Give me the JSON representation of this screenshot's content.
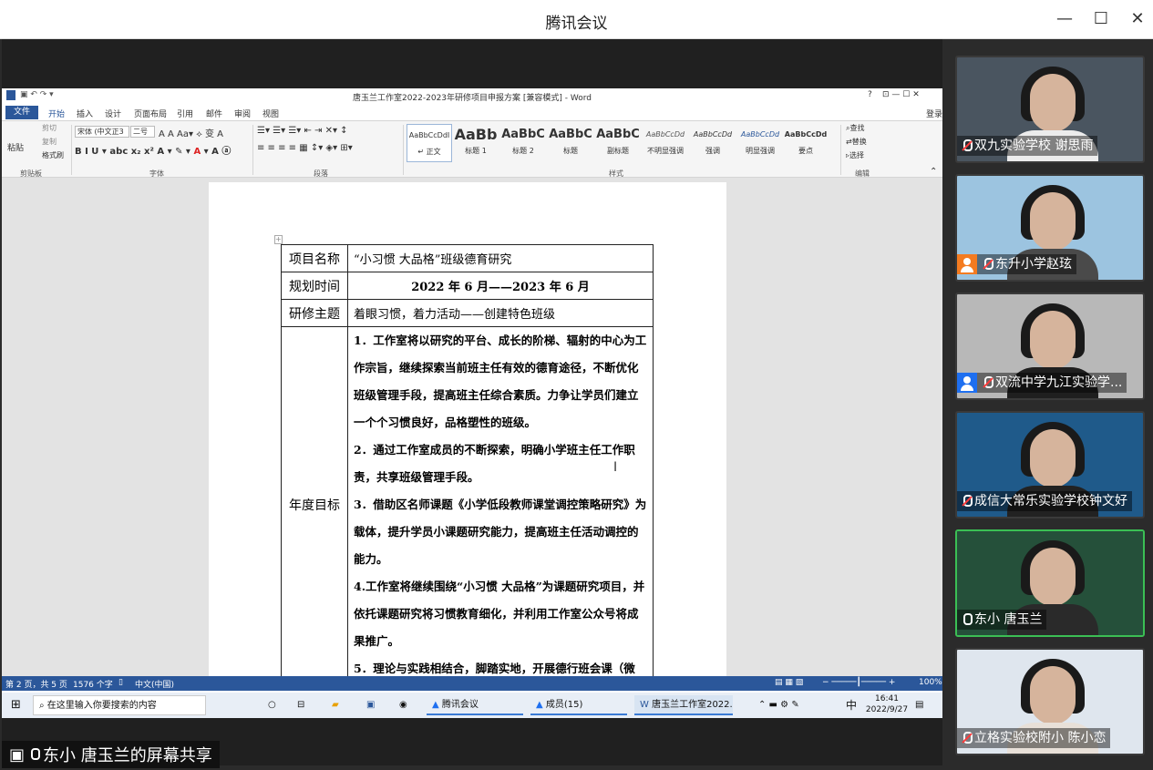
{
  "app": {
    "title": "腾讯会议"
  },
  "window_controls": {
    "minimize": "—",
    "maximize": "☐",
    "close": "✕"
  },
  "word": {
    "title": "唐玉兰工作室2022-2023年研修项目申报方案 [兼容模式] - Word",
    "help": "?",
    "login": "登录",
    "tabs": [
      "文件",
      "开始",
      "插入",
      "设计",
      "页面布局",
      "引用",
      "邮件",
      "审阅",
      "视图"
    ],
    "clipboard": {
      "paste": "粘贴",
      "cut": "剪切",
      "copy": "复制",
      "format_painter": "格式刷",
      "group": "剪贴板"
    },
    "font": {
      "name": "宋体 (中文正3",
      "size": "二号",
      "group": "字体"
    },
    "paragraph_group": "段落",
    "styles": [
      {
        "preview": "AaBbCcDdI",
        "label": "↵ 正文"
      },
      {
        "preview": "AaBb",
        "label": "标题 1"
      },
      {
        "preview": "AaBbC",
        "label": "标题 2"
      },
      {
        "preview": "AaBbC",
        "label": "标题"
      },
      {
        "preview": "AaBbC",
        "label": "副标题"
      },
      {
        "preview": "AaBbCcDd",
        "label": "不明显强调"
      },
      {
        "preview": "AaBbCcDd",
        "label": "强调"
      },
      {
        "preview": "AaBbCcDd",
        "label": "明显强调"
      },
      {
        "preview": "AaBbCcDd",
        "label": "要点"
      }
    ],
    "styles_group": "样式",
    "editing": {
      "find": "查找",
      "replace": "替换",
      "select": "选择",
      "group": "编辑"
    },
    "table": {
      "rows": [
        {
          "label": "项目名称",
          "value": "“小习惯 大品格”班级德育研究"
        },
        {
          "label": "规划时间",
          "value": "2022 年 6 月——2023 年 6 月"
        },
        {
          "label": "研修主题",
          "value": "着眼习惯，着力活动——创建特色班级"
        }
      ],
      "goal_label": "年度目标",
      "goals": [
        "1．工作室将以研究的平台、成长的阶梯、辐射的中心为工作宗旨，继续探索当前班主任有效的德育途径，不断优化班级管理手段，提高班主任综合素质。力争让学员们建立一个个习惯良好，品格塑性的班级。",
        "2．通过工作室成员的不断探索，明确小学班主任工作职责，共享班级管理手段。",
        "3．借助区名师课题《小学低段教师课堂调控策略研究》为载体，提升学员小课题研究能力，提高班主任活动调控的能力。",
        "4.工作室将继续围绕“小习惯 大品格”为课题研究项目，并依托课题研究将习惯教育细化，并利用工作室公众号将成果推广。",
        "5．理论与实践相结合，脚踏实地，开展德行班会课（微"
      ]
    },
    "status": {
      "page": "第 2 页，共 5 页",
      "words": "1576 个字",
      "lang": "中文(中国)",
      "zoom": "100%"
    }
  },
  "taskbar": {
    "search_placeholder": "在这里输入你要搜索的内容",
    "apps": [
      "腾讯会议",
      "成员(15)",
      "唐玉兰工作室2022..."
    ],
    "ime": "中",
    "time": "16:41",
    "date": "2022/9/27"
  },
  "share_label": "东小  唐玉兰的屏幕共享",
  "participants": [
    {
      "name": "双九实验学校 谢思雨",
      "mic": "off",
      "badge": "none",
      "bg": "#4a5560",
      "shirt": "#ececec"
    },
    {
      "name": "东升小学赵玹",
      "mic": "off",
      "badge": "orange",
      "bg": "#9cc4e0",
      "shirt": "#4a4a4a"
    },
    {
      "name": "双流中学九江实验学...",
      "mic": "off",
      "badge": "blue",
      "bg": "#b8b8b8",
      "shirt": "#1f1f1f"
    },
    {
      "name": "成信大常乐实验学校钟文好",
      "mic": "off",
      "badge": "none",
      "bg": "#1f5a8a",
      "shirt": "#222"
    },
    {
      "name": "东小  唐玉兰",
      "mic": "on",
      "badge": "none",
      "bg": "#25503a",
      "shirt": "#2a2a2a"
    },
    {
      "name": "立格实验校附小 陈小恋",
      "mic": "off",
      "badge": "none",
      "bg": "#dfe6ee",
      "shirt": "#e8e0d8"
    }
  ]
}
